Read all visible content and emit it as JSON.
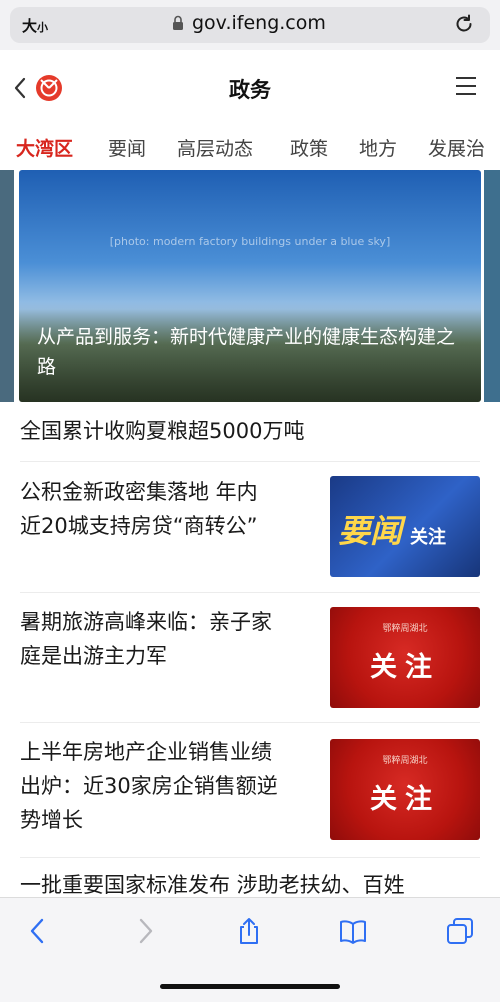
{
  "browser": {
    "text_size_label": "大小",
    "text_size_small": "小",
    "text_size_big": "大",
    "url": "gov.ifeng.com"
  },
  "header": {
    "title": "政务"
  },
  "tabs": [
    "大湾区",
    "要闻",
    "高层动态",
    "政策",
    "地方",
    "发展治"
  ],
  "hero": {
    "caption": "从产品到服务：新时代健康产业的健康生态构建之路",
    "image_label": "[photo: modern factory buildings under a blue sky]"
  },
  "articles": [
    {
      "title_line1": "全国累计收购夏粮超5000万吨"
    },
    {
      "title_line1": "公积金新政密集落地 年内",
      "title_line2": "近20城支持房贷“商转公”",
      "thumb_big": "要闻",
      "thumb_small": "关注"
    },
    {
      "title_line1": "暑期旅游高峰来临：亲子家",
      "title_line2": "庭是出游主力军",
      "thumb_brand": "鄂粹周湖北",
      "thumb_big": "关注"
    },
    {
      "title_line1": "上半年房地产企业销售业绩",
      "title_line2": "出炉：近30家房企销售额逆",
      "title_line3": "势增长",
      "thumb_brand": "鄂粹周湖北",
      "thumb_big": "关注"
    },
    {
      "title_line1": "一批重要国家标准发布 涉助老扶幼、百姓"
    }
  ],
  "colors": {
    "accent": "#d8261e",
    "ios_blue": "#2f6ff3"
  }
}
